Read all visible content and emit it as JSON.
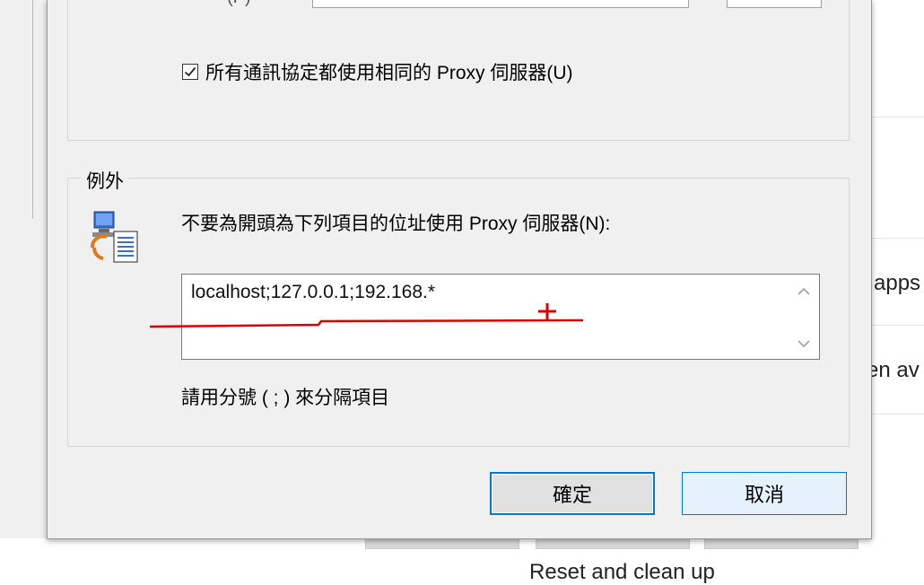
{
  "dialog": {
    "top_label": "(P)",
    "same_proxy_checkbox": {
      "label": "所有通訊協定都使用相同的 Proxy 伺服器(U)",
      "checked": true
    },
    "exceptions": {
      "group_title": "例外",
      "description": "不要為開頭為下列項目的位址使用 Proxy 伺服器(N):",
      "value": "localhost;127.0.0.1;192.168.*",
      "hint": "請用分號 ( ; ) 來分隔項目"
    },
    "buttons": {
      "ok": "確定",
      "cancel": "取消"
    }
  },
  "background": {
    "right_text_1": "apps",
    "right_text_2": "en av",
    "bottom_text": "Reset and clean up"
  },
  "colors": {
    "accent": "#0078d7",
    "annotation": "#e00000",
    "dialog_bg": "#f0f0f0"
  },
  "icons": {
    "checkbox": "check-icon",
    "exceptions": "network-document-icon",
    "scroll_up": "chevron-up-icon",
    "scroll_down": "chevron-down-icon"
  }
}
